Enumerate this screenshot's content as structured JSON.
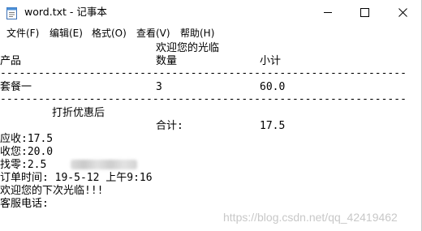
{
  "window": {
    "title": "word.txt - 记事本",
    "controls": {
      "minimize": "minimize",
      "maximize": "maximize",
      "close": "close"
    }
  },
  "menu": [
    {
      "label": "文件(F)"
    },
    {
      "label": "编辑(E)"
    },
    {
      "label": "格式(O)"
    },
    {
      "label": "查看(V)"
    },
    {
      "label": "帮助(H)"
    }
  ],
  "doc": {
    "welcome": "欢迎您的光临",
    "header": {
      "product": "产品",
      "qty": "数量",
      "subtotal": "小计"
    },
    "divider": "----------------------------------------------------------------",
    "row": {
      "product": "套餐一",
      "qty": "3",
      "subtotal": "60.0"
    },
    "discount": "打折优惠后",
    "total_label": "合计:",
    "total_value": "17.5",
    "due": "应收:17.5",
    "received": "收您:20.0",
    "change": "找零:2.5",
    "order_time": "订单时间: 19-5-12 上午9:16",
    "farewell": "欢迎您的下次光临!!!",
    "service_label": "客服电话:"
  },
  "watermark": "https://blog.csdn.net/qq_42419462"
}
